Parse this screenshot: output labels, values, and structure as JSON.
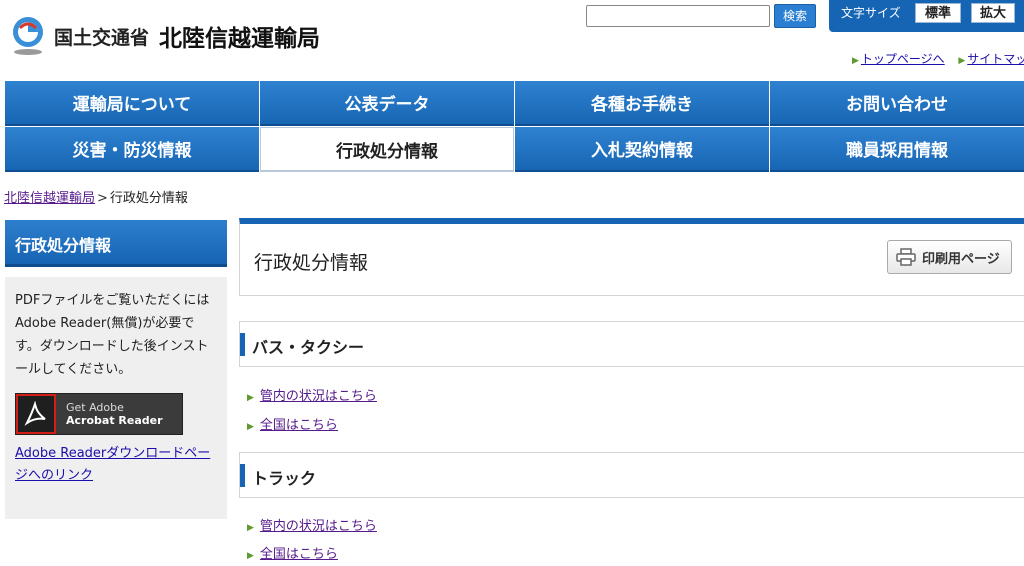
{
  "header": {
    "ministry": "国土交通省",
    "bureau": "北陸信越運輸局",
    "search": {
      "placeholder": "",
      "button_label": "検索"
    },
    "font_size": {
      "label": "文字サイズ",
      "standard": "標準",
      "large": "拡大"
    },
    "util_links": [
      "トップページへ",
      "サイトマップ"
    ]
  },
  "nav": {
    "row1": [
      "運輸局について",
      "公表データ",
      "各種お手続き",
      "お問い合わせ"
    ],
    "row2": [
      "災害・防災情報",
      "行政処分情報",
      "入札契約情報",
      "職員採用情報"
    ],
    "active": "行政処分情報"
  },
  "breadcrumb": {
    "home": "北陸信越運輸局",
    "separator": ">",
    "current": "行政処分情報"
  },
  "sidebar": {
    "title": "行政処分情報",
    "note": "PDFファイルをご覧いただくにはAdobe Reader(無償)が必要です。ダウンロードした後インストールしてください。",
    "badge_line1": "Get Adobe",
    "badge_line2": "Acrobat Reader",
    "download_link": "Adobe Readerダウンロードページへのリンク"
  },
  "main": {
    "title": "行政処分情報",
    "print_label": "印刷用ページ",
    "sections": [
      {
        "heading": "バス・タクシー",
        "links": [
          "管内の状況はこちら",
          "全国はこちら"
        ]
      },
      {
        "heading": "トラック",
        "links": [
          "管内の状況はこちら",
          "全国はこちら"
        ]
      }
    ]
  },
  "colors": {
    "primary": "#1664b3",
    "accent_green": "#5e9a2e",
    "sidebar_bg": "#efefef"
  }
}
